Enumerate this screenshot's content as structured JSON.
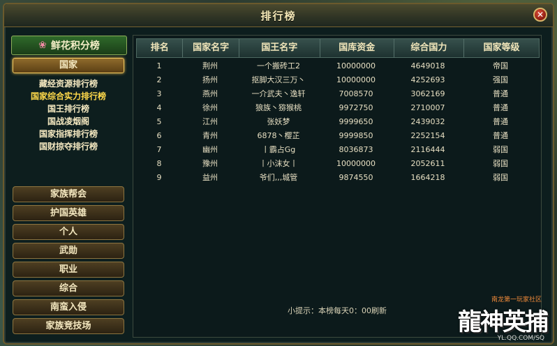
{
  "window": {
    "title": "排行榜"
  },
  "left": {
    "rank_header": "鲜花积分榜",
    "active_category": "国家",
    "sub_items": [
      "藏经资源排行榜",
      "国家综合实力排行榜",
      "国王排行榜",
      "国战凌烟阁",
      "国家指挥排行榜",
      "国财掠夺排行榜"
    ],
    "active_sub_index": 1,
    "bottom_buttons": [
      "家族帮会",
      "护国英雄",
      "个人",
      "武勋",
      "职业",
      "综合",
      "南蛮入侵",
      "家族竞技场"
    ]
  },
  "table": {
    "headers": [
      "排名",
      "国家名字",
      "国王名字",
      "国库资金",
      "综合国力",
      "国家等级"
    ],
    "rows": [
      [
        "1",
        "荆州",
        "一个搬砖工2",
        "10000000",
        "4649018",
        "帝国"
      ],
      [
        "2",
        "扬州",
        "抠脚大汉三万丶",
        "10000000",
        "4252693",
        "强国"
      ],
      [
        "3",
        "燕州",
        "一介武夫丶逸轩",
        "7008570",
        "3062169",
        "普通"
      ],
      [
        "4",
        "徐州",
        "狼族丶猕猴桃",
        "9972750",
        "2710007",
        "普通"
      ],
      [
        "5",
        "江州",
        "张妖梦",
        "9999650",
        "2439032",
        "普通"
      ],
      [
        "6",
        "青州",
        "6878丶樱芷",
        "9999850",
        "2252154",
        "普通"
      ],
      [
        "7",
        "幽州",
        "丨霸占Gg",
        "8036873",
        "2116444",
        "弱国"
      ],
      [
        "8",
        "豫州",
        "丨小沫女丨",
        "10000000",
        "2052611",
        "弱国"
      ],
      [
        "9",
        "益州",
        "爷们,,,城管",
        "9874550",
        "1664218",
        "弱国"
      ]
    ]
  },
  "tip": "小提示：本榜每天0：00刷新",
  "logo": {
    "small": "南龙第一玩家社区",
    "main": "龍神英捕",
    "url": "YL.QQ.COM/SQ"
  }
}
